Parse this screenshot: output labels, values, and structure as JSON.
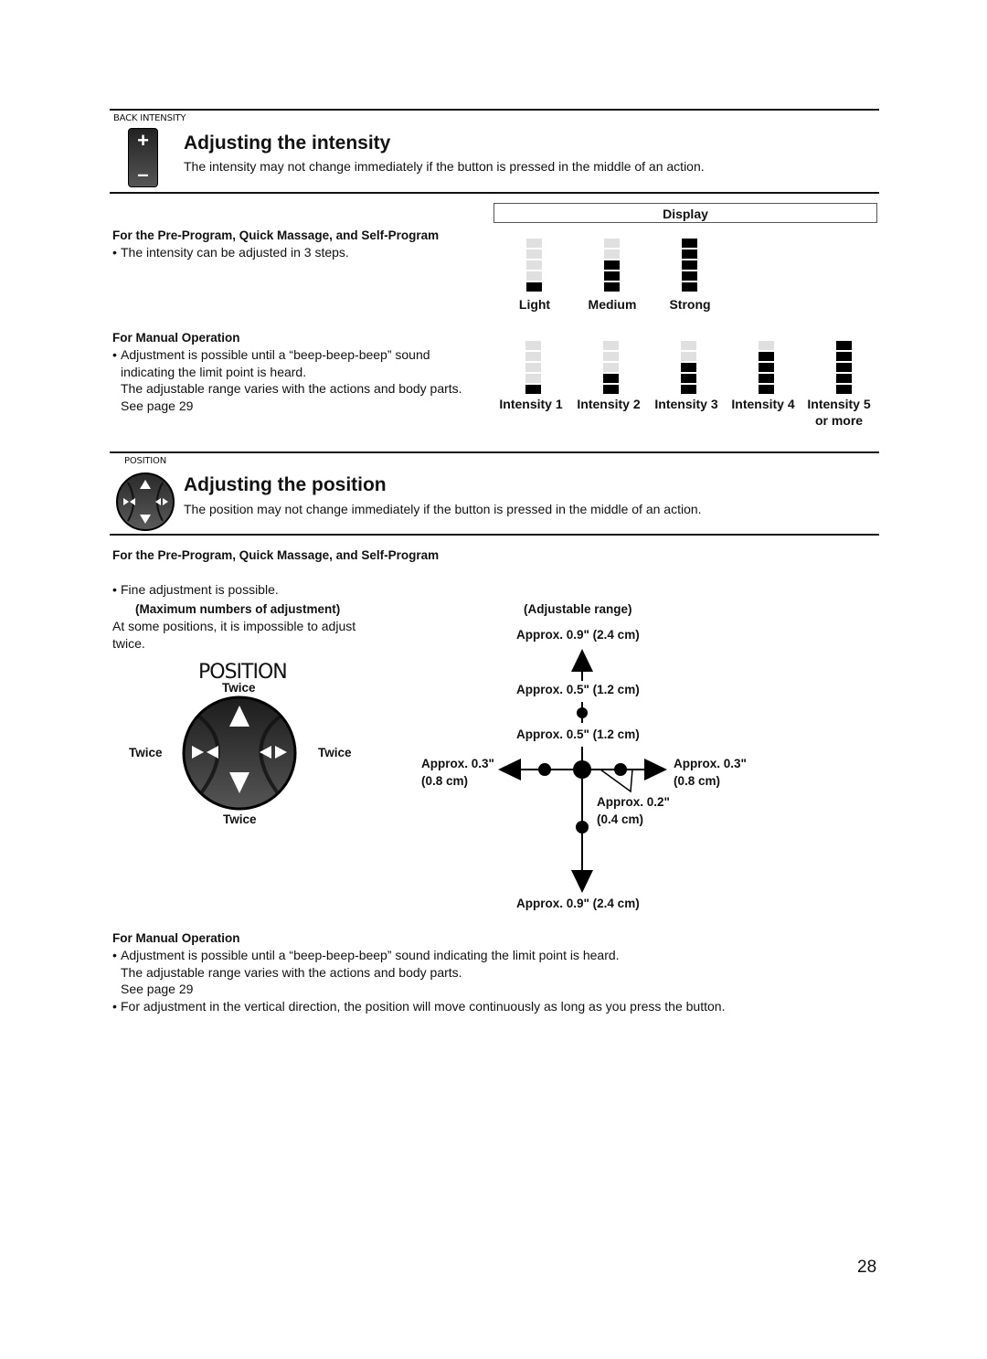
{
  "page_number": "28",
  "intensity_section": {
    "button_tag": "BACK INTENSITY",
    "button_plus": "+",
    "button_minus": "–",
    "title": "Adjusting the intensity",
    "lead": "The intensity may not change immediately if the button is pressed in the middle of an action.",
    "preprogram": {
      "heading": "For the Pre-Program, Quick Massage, and Self-Program",
      "bullet": "The intensity can be adjusted in 3 steps."
    },
    "manual": {
      "heading": "For Manual Operation",
      "bullet_line1": "Adjustment is possible until a “beep-beep-beep” sound",
      "bullet_line2": "indicating the limit point is heard.",
      "bullet_line3": "The adjustable range varies with the actions and body parts.",
      "bullet_line4": "See page 29"
    },
    "display": {
      "header": "Display",
      "preprogram_levels": [
        {
          "label": "Light",
          "filled": 1,
          "total": 5
        },
        {
          "label": "Medium",
          "filled": 3,
          "total": 5
        },
        {
          "label": "Strong",
          "filled": 5,
          "total": 5
        }
      ],
      "manual_levels": [
        {
          "label": "Intensity 1",
          "label2": "",
          "filled": 1,
          "total": 5
        },
        {
          "label": "Intensity 2",
          "label2": "",
          "filled": 2,
          "total": 5
        },
        {
          "label": "Intensity 3",
          "label2": "",
          "filled": 3,
          "total": 5
        },
        {
          "label": "Intensity 4",
          "label2": "",
          "filled": 4,
          "total": 5
        },
        {
          "label": "Intensity 5",
          "label2": "or more",
          "filled": 5,
          "total": 5
        }
      ]
    }
  },
  "position_section": {
    "button_tag": "POSITION",
    "title": "Adjusting the position",
    "lead": "The position may not change immediately if the button is pressed in the middle of an action.",
    "preprogram": {
      "heading": "For the Pre-Program, Quick Massage, and Self-Program",
      "bullet": "Fine adjustment is possible."
    },
    "max_adjust": {
      "heading": "(Maximum numbers of adjustment)",
      "text_line1": "At some positions, it is impossible to adjust",
      "text_line2": "twice.",
      "dial_title": "POSITION",
      "top": "Twice",
      "left": "Twice",
      "right": "Twice",
      "bottom": "Twice"
    },
    "range": {
      "heading": "(Adjustable range)",
      "up_max": "Approx. 0.9\" (2.4 cm)",
      "up_step": "Approx. 0.5\" (1.2 cm)",
      "up_step2": "Approx. 0.5\" (1.2 cm)",
      "left_line1": "Approx. 0.3\"",
      "left_line2": "(0.8 cm)",
      "right_line1": "Approx. 0.3\"",
      "right_line2": "(0.8 cm)",
      "fine_line1": "Approx. 0.2\"",
      "fine_line2": "(0.4 cm)",
      "down_max": "Approx. 0.9\" (2.4 cm)"
    },
    "manual": {
      "heading": "For Manual Operation",
      "bullet1_line1": "Adjustment is possible until a “beep-beep-beep” sound indicating the limit point is heard.",
      "bullet1_line2": "The adjustable range varies with the actions and body parts.",
      "bullet1_line3": "See page 29",
      "bullet2": "For adjustment in the vertical direction, the position will move continuously as long as you press the button."
    }
  }
}
